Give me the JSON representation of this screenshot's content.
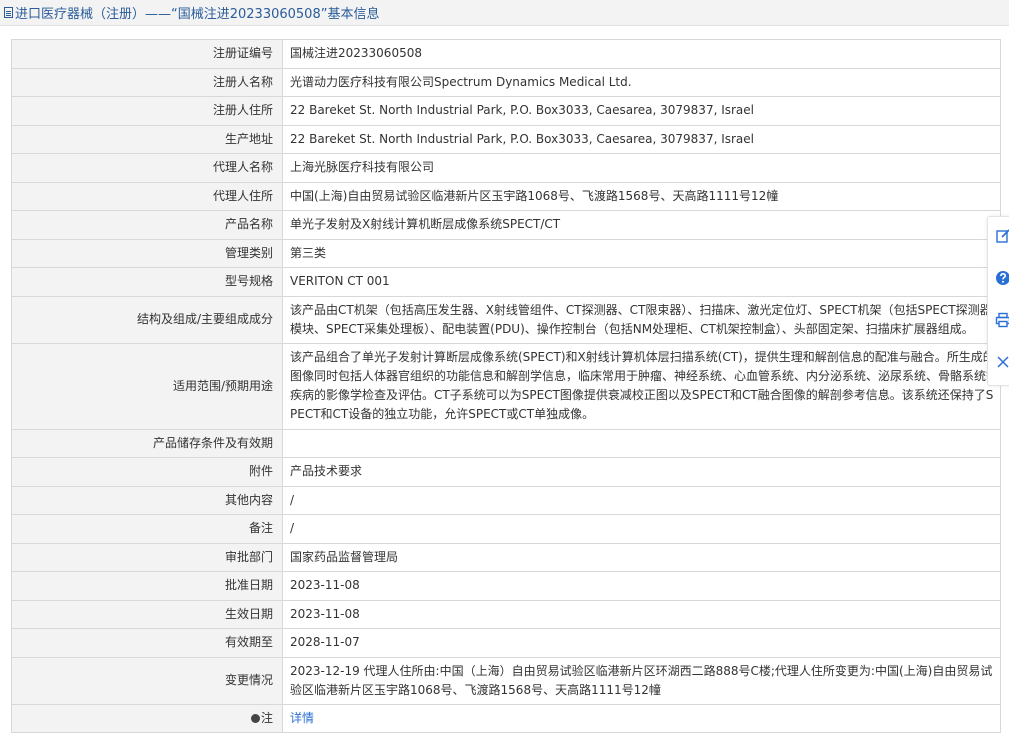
{
  "header": {
    "title": "进口医疗器械（注册）——“国械注进20233060508”基本信息"
  },
  "rows": [
    {
      "label": "注册证编号",
      "value": "国械注进20233060508"
    },
    {
      "label": "注册人名称",
      "value": "光谱动力医疗科技有限公司Spectrum Dynamics Medical Ltd."
    },
    {
      "label": "注册人住所",
      "value": "22 Bareket St. North Industrial Park, P.O. Box3033, Caesarea, 3079837, Israel"
    },
    {
      "label": "生产地址",
      "value": "22 Bareket St. North Industrial Park, P.O. Box3033, Caesarea, 3079837, Israel"
    },
    {
      "label": "代理人名称",
      "value": "上海光脉医疗科技有限公司"
    },
    {
      "label": "代理人住所",
      "value": "中国(上海)自由贸易试验区临港新片区玉宇路1068号、飞渡路1568号、天高路1111号12幢"
    },
    {
      "label": "产品名称",
      "value": "单光子发射及X射线计算机断层成像系统SPECT/CT"
    },
    {
      "label": "管理类别",
      "value": "第三类"
    },
    {
      "label": "型号规格",
      "value": "VERITON CT 001"
    },
    {
      "label": "结构及组成/主要组成成分",
      "value": "该产品由CT机架（包括高压发生器、X射线管组件、CT探测器、CT限束器）、扫描床、激光定位灯、SPECT机架（包括SPECT探测器模块、SPECT采集处理板）、配电装置(PDU)、操作控制台（包括NM处理柜、CT机架控制盒）、头部固定架、扫描床扩展器组成。"
    },
    {
      "label": "适用范围/预期用途",
      "value": "该产品组合了单光子发射计算断层成像系统(SPECT)和X射线计算机体层扫描系统(CT)，提供生理和解剖信息的配准与融合。所生成的图像同时包括人体器官组织的功能信息和解剖学信息，临床常用于肿瘤、神经系统、心血管系统、内分泌系统、泌尿系统、骨骼系统等疾病的影像学检查及评估。CT子系统可以为SPECT图像提供衰减校正图以及SPECT和CT融合图像的解剖参考信息。该系统还保持了SPECT和CT设备的独立功能，允许SPECT或CT单独成像。"
    },
    {
      "label": "产品储存条件及有效期",
      "value": ""
    },
    {
      "label": "附件",
      "value": "产品技术要求"
    },
    {
      "label": "其他内容",
      "value": "/"
    },
    {
      "label": "备注",
      "value": "/"
    },
    {
      "label": "审批部门",
      "value": "国家药品监督管理局"
    },
    {
      "label": "批准日期",
      "value": "2023-11-08"
    },
    {
      "label": "生效日期",
      "value": "2023-11-08"
    },
    {
      "label": "有效期至",
      "value": "2028-11-07"
    },
    {
      "label": "变更情况",
      "value": "2023-12-19 代理人住所由:中国（上海）自由贸易试验区临港新片区环湖西二路888号C楼;代理人住所变更为:中国(上海)自由贸易试验区临港新片区玉宇路1068号、飞渡路1568号、天高路1111号12幢"
    }
  ],
  "note": {
    "label": "注",
    "link": "详情"
  },
  "side_toolbar": [
    "edit-icon",
    "help-icon",
    "print-icon",
    "close-icon"
  ],
  "colors": {
    "link": "#2a6fd6",
    "header_text": "#2a5c9a",
    "label_bg": "#f3f3f3",
    "border": "#d8d8d8"
  }
}
